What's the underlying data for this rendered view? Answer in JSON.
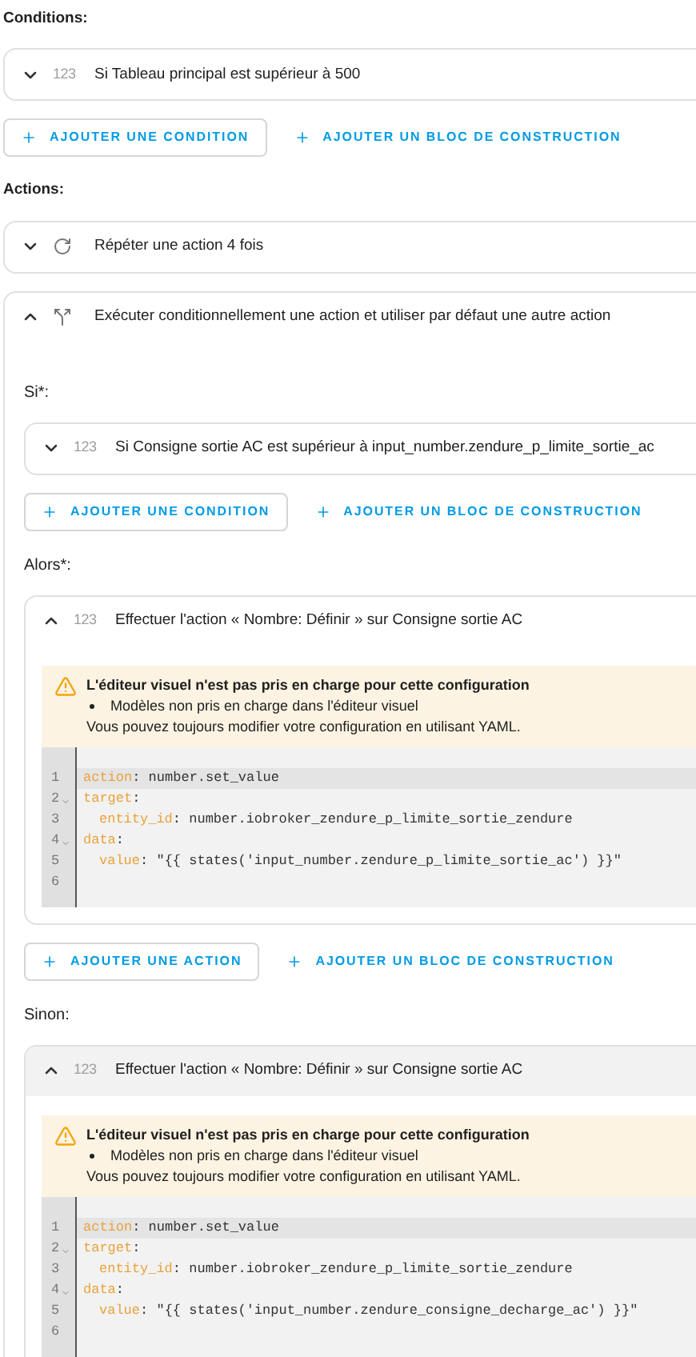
{
  "conditions": {
    "label": "Conditions:",
    "items": [
      {
        "kind": "number",
        "badge": "123",
        "title": "Si Tableau principal est supérieur à 500",
        "expanded": false
      }
    ],
    "buttons": [
      {
        "label": "AJOUTER UNE CONDITION",
        "outlined": true
      },
      {
        "label": "AJOUTER UN BLOC DE CONSTRUCTION",
        "outlined": false
      }
    ]
  },
  "actions": {
    "label": "Actions:",
    "items": [
      {
        "kind": "repeat",
        "title": "Répéter une action 4 fois",
        "expanded": false
      },
      {
        "kind": "choose",
        "title": "Exécuter conditionnellement une action et utiliser par défaut une autre action",
        "expanded": true,
        "sections": [
          {
            "label": "Si*:",
            "items": [
              {
                "kind": "number",
                "badge": "123",
                "title": "Si Consigne sortie AC est supérieur à input_number.zendure_p_limite_sortie_ac",
                "expanded": false,
                "highlighted": false
              }
            ],
            "buttons": [
              {
                "label": "AJOUTER UNE CONDITION",
                "outlined": true
              },
              {
                "label": "AJOUTER UN BLOC DE CONSTRUCTION",
                "outlined": false
              }
            ]
          },
          {
            "label": "Alors*:",
            "items": [
              {
                "kind": "number",
                "badge": "123",
                "title": "Effectuer l'action « Nombre: Définir » sur Consigne sortie AC",
                "expanded": true,
                "highlighted": false,
                "warning": {
                  "title": "L'éditeur visuel n'est pas pris en charge pour cette configuration",
                  "bullets": [
                    "Modèles non pris en charge dans l'éditeur visuel"
                  ],
                  "text": "Vous pouvez toujours modifier votre configuration en utilisant YAML."
                },
                "code": [
                  {
                    "number": "1",
                    "active": true,
                    "fold": false,
                    "indented": false,
                    "segments": [
                      {
                        "kind": "key",
                        "text": "action"
                      },
                      {
                        "kind": "plain",
                        "text": ": number.set_value"
                      }
                    ]
                  },
                  {
                    "number": "2",
                    "active": false,
                    "fold": true,
                    "indented": false,
                    "segments": [
                      {
                        "kind": "key",
                        "text": "target"
                      },
                      {
                        "kind": "plain",
                        "text": ":"
                      }
                    ]
                  },
                  {
                    "number": "3",
                    "active": false,
                    "fold": false,
                    "indented": true,
                    "segments": [
                      {
                        "kind": "key",
                        "text": "entity_id"
                      },
                      {
                        "kind": "plain",
                        "text": ": number.iobroker_zendure_p_limite_sortie_zendure"
                      }
                    ]
                  },
                  {
                    "number": "4",
                    "active": false,
                    "fold": true,
                    "indented": false,
                    "segments": [
                      {
                        "kind": "key",
                        "text": "data"
                      },
                      {
                        "kind": "plain",
                        "text": ":"
                      }
                    ]
                  },
                  {
                    "number": "5",
                    "active": false,
                    "fold": false,
                    "indented": true,
                    "segments": [
                      {
                        "kind": "key",
                        "text": "value"
                      },
                      {
                        "kind": "plain",
                        "text": ": \"{{ states('input_number.zendure_p_limite_sortie_ac') }}\""
                      }
                    ]
                  },
                  {
                    "number": "6",
                    "active": false,
                    "fold": false
                  }
                ]
              }
            ],
            "buttons": [
              {
                "label": "AJOUTER UNE ACTION",
                "outlined": true
              },
              {
                "label": "AJOUTER UN BLOC DE CONSTRUCTION",
                "outlined": false
              }
            ]
          },
          {
            "label": "Sinon:",
            "items": [
              {
                "kind": "number",
                "badge": "123",
                "title": "Effectuer l'action « Nombre: Définir » sur Consigne sortie AC",
                "expanded": true,
                "highlighted": true,
                "warning": {
                  "title": "L'éditeur visuel n'est pas pris en charge pour cette configuration",
                  "bullets": [
                    "Modèles non pris en charge dans l'éditeur visuel"
                  ],
                  "text": "Vous pouvez toujours modifier votre configuration en utilisant YAML."
                },
                "code": [
                  {
                    "number": "1",
                    "active": true,
                    "fold": false,
                    "indented": false,
                    "segments": [
                      {
                        "kind": "key",
                        "text": "action"
                      },
                      {
                        "kind": "plain",
                        "text": ": number.set_value"
                      }
                    ]
                  },
                  {
                    "number": "2",
                    "active": false,
                    "fold": true,
                    "indented": false,
                    "segments": [
                      {
                        "kind": "key",
                        "text": "target"
                      },
                      {
                        "kind": "plain",
                        "text": ":"
                      }
                    ]
                  },
                  {
                    "number": "3",
                    "active": false,
                    "fold": false,
                    "indented": true,
                    "segments": [
                      {
                        "kind": "key",
                        "text": "entity_id"
                      },
                      {
                        "kind": "plain",
                        "text": ": number.iobroker_zendure_p_limite_sortie_zendure"
                      }
                    ]
                  },
                  {
                    "number": "4",
                    "active": false,
                    "fold": true,
                    "indented": false,
                    "segments": [
                      {
                        "kind": "key",
                        "text": "data"
                      },
                      {
                        "kind": "plain",
                        "text": ":"
                      }
                    ]
                  },
                  {
                    "number": "5",
                    "active": false,
                    "fold": false,
                    "indented": true,
                    "segments": [
                      {
                        "kind": "key",
                        "text": "value"
                      },
                      {
                        "kind": "plain",
                        "text": ": \"{{ states('input_number.zendure_consigne_decharge_ac') }}\""
                      }
                    ]
                  },
                  {
                    "number": "6",
                    "active": false,
                    "fold": false
                  }
                ]
              }
            ]
          }
        ]
      }
    ]
  }
}
